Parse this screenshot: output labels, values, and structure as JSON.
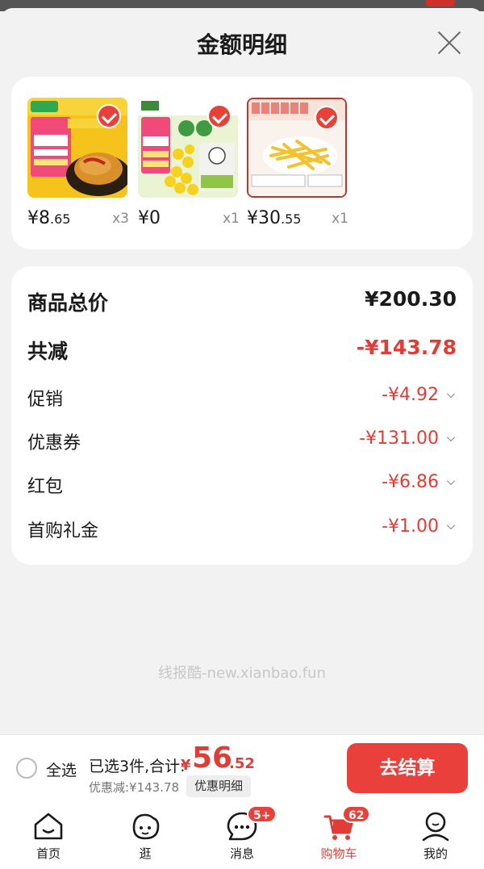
{
  "sheet": {
    "title": "金额明细",
    "close_icon": "close-icon"
  },
  "products": [
    {
      "name_icon": "chicken-cutlet-product-image",
      "price_int": "¥8",
      "price_dec": ".65",
      "qty": "x3",
      "selected": true
    },
    {
      "name_icon": "sweet-corn-product-image",
      "price_int": "¥0",
      "price_dec": "",
      "qty": "x1",
      "selected": true
    },
    {
      "name_icon": "french-fries-product-image",
      "price_int": "¥30",
      "price_dec": ".55",
      "qty": "x1",
      "selected": true
    }
  ],
  "summary": {
    "total_label": "商品总价",
    "total_value": "¥200.30",
    "reduce_label": "共减",
    "reduce_value": "-¥143.78",
    "items": [
      {
        "label": "促销",
        "value": "-¥4.92"
      },
      {
        "label": "优惠券",
        "value": "-¥131.00"
      },
      {
        "label": "红包",
        "value": "-¥6.86"
      },
      {
        "label": "首购礼金",
        "value": "-¥1.00"
      }
    ]
  },
  "watermark": "线报酷-new.xianbao.fun",
  "bottom_bar": {
    "select_all": "全选",
    "selected_count": "已选3件,合计:",
    "total_currency": "¥",
    "total_int": "56",
    "total_dec": ".52",
    "discount_text": "优惠减:¥143.78",
    "detail_button": "优惠明细",
    "checkout_button": "去结算"
  },
  "tabbar": [
    {
      "label": "首页",
      "icon": "home-icon",
      "badge": ""
    },
    {
      "label": "逛",
      "icon": "browse-face-icon",
      "badge": ""
    },
    {
      "label": "消息",
      "icon": "message-bubble-icon",
      "badge": "5+"
    },
    {
      "label": "购物车",
      "icon": "shopping-cart-icon",
      "badge": "62",
      "active": true
    },
    {
      "label": "我的",
      "icon": "profile-icon",
      "badge": ""
    }
  ],
  "colors": {
    "accent": "#e8413a",
    "price_red": "#e23c36",
    "background": "#f2f2f2"
  }
}
